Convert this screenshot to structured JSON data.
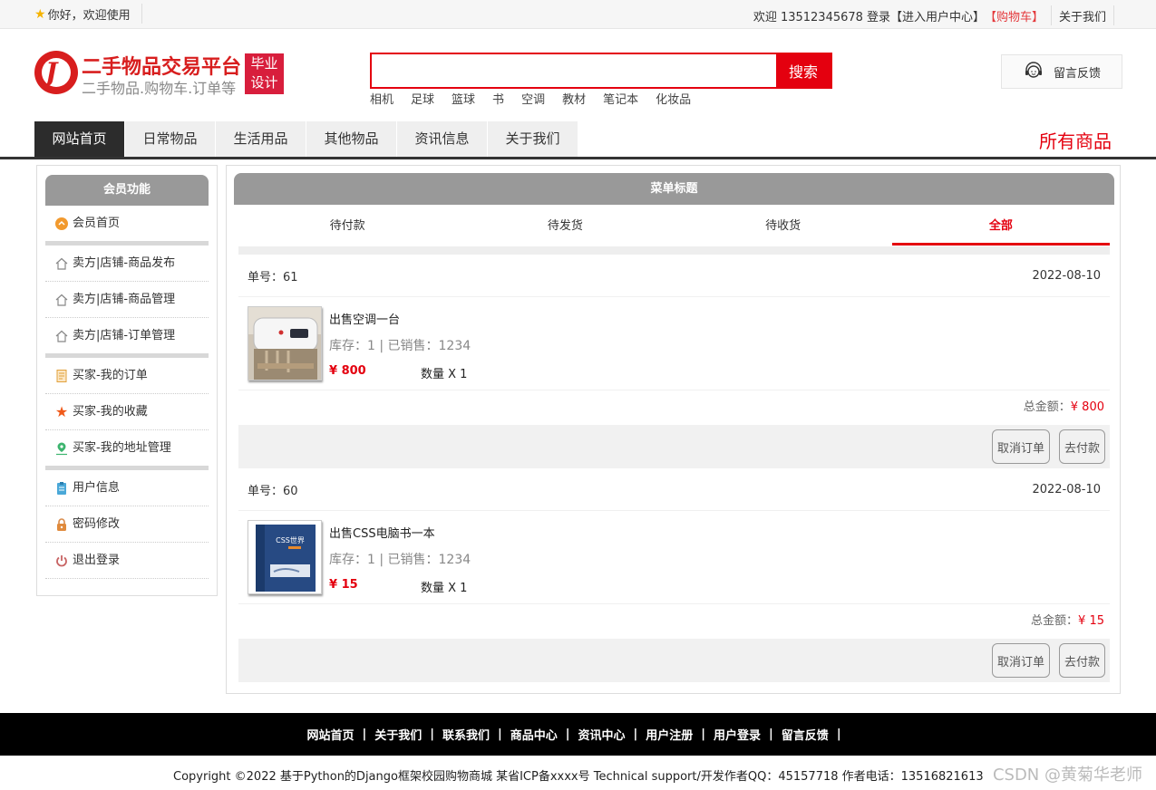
{
  "topbar": {
    "greeting": "你好，欢迎使用",
    "welcome_user": "欢迎 13512345678",
    "login": "登录",
    "user_center": "【进入用户中心】",
    "cart": "【购物车】",
    "about": "关于我们"
  },
  "logo": {
    "title": "二手物品交易平台",
    "subtitle": "二手物品.购物车.订单等",
    "badge_line1": "毕业",
    "badge_line2": "设计"
  },
  "search": {
    "placeholder": "",
    "button": "搜索",
    "hotwords": [
      "相机",
      "足球",
      "篮球",
      "书",
      "空调",
      "教材",
      "笔记本",
      "化妆品"
    ]
  },
  "feedback": {
    "label": "留言反馈"
  },
  "nav": {
    "items": [
      "网站首页",
      "日常物品",
      "生活用品",
      "其他物品",
      "资讯信息",
      "关于我们"
    ],
    "active_index": 0,
    "all_goods": "所有商品"
  },
  "sidebar": {
    "title": "会员功能",
    "items": [
      {
        "label": "会员首页",
        "icon": "home-circle-icon"
      },
      {
        "label": "卖方|店铺-商品发布",
        "icon": "house-icon"
      },
      {
        "label": "卖方|店铺-商品管理",
        "icon": "house-icon"
      },
      {
        "label": "卖方|店铺-订单管理",
        "icon": "house-icon"
      },
      {
        "label": "买家-我的订单",
        "icon": "document-icon"
      },
      {
        "label": "买家-我的收藏",
        "icon": "star-icon"
      },
      {
        "label": "买家-我的地址管理",
        "icon": "location-pin-icon"
      },
      {
        "label": "用户信息",
        "icon": "clipboard-icon"
      },
      {
        "label": "密码修改",
        "icon": "lock-icon"
      },
      {
        "label": "退出登录",
        "icon": "power-icon"
      }
    ]
  },
  "main": {
    "menu_title": "菜单标题",
    "tabs": [
      "待付款",
      "待发货",
      "待收货",
      "全部"
    ],
    "active_tab": 3,
    "orders": [
      {
        "order_label": "单号：61",
        "date": "2022-08-10",
        "item_name": "出售空调一台",
        "stock_line": "库存：1 | 已销售：1234",
        "price": "¥ 800",
        "qty": "数量 X 1",
        "total_label": "总金额：",
        "total_amount": "¥ 800",
        "cancel": "取消订单",
        "pay": "去付款"
      },
      {
        "order_label": "单号：60",
        "date": "2022-08-10",
        "item_name": "出售CSS电脑书一本",
        "stock_line": "库存：1 | 已销售：1234",
        "price": "¥ 15",
        "qty": "数量 X 1",
        "total_label": "总金额：",
        "total_amount": "¥ 15",
        "cancel": "取消订单",
        "pay": "去付款"
      }
    ],
    "book_cover_text": "CSS世界"
  },
  "footer": {
    "links": [
      "网站首页",
      "关于我们",
      "联系我们",
      "商品中心",
      "资讯中心",
      "用户注册",
      "用户登录",
      "留言反馈"
    ],
    "copyright": "Copyright ©2022 基于Python的Django框架校园购物商城 某省ICP备xxxx号    Technical support/开发作者QQ：45157718     作者电话：13516821613",
    "watermark": "CSDN @黄菊华老师"
  },
  "colors": {
    "accent": "#e4000f",
    "nav_active": "#2c2c2c",
    "header_grey": "#999999"
  }
}
